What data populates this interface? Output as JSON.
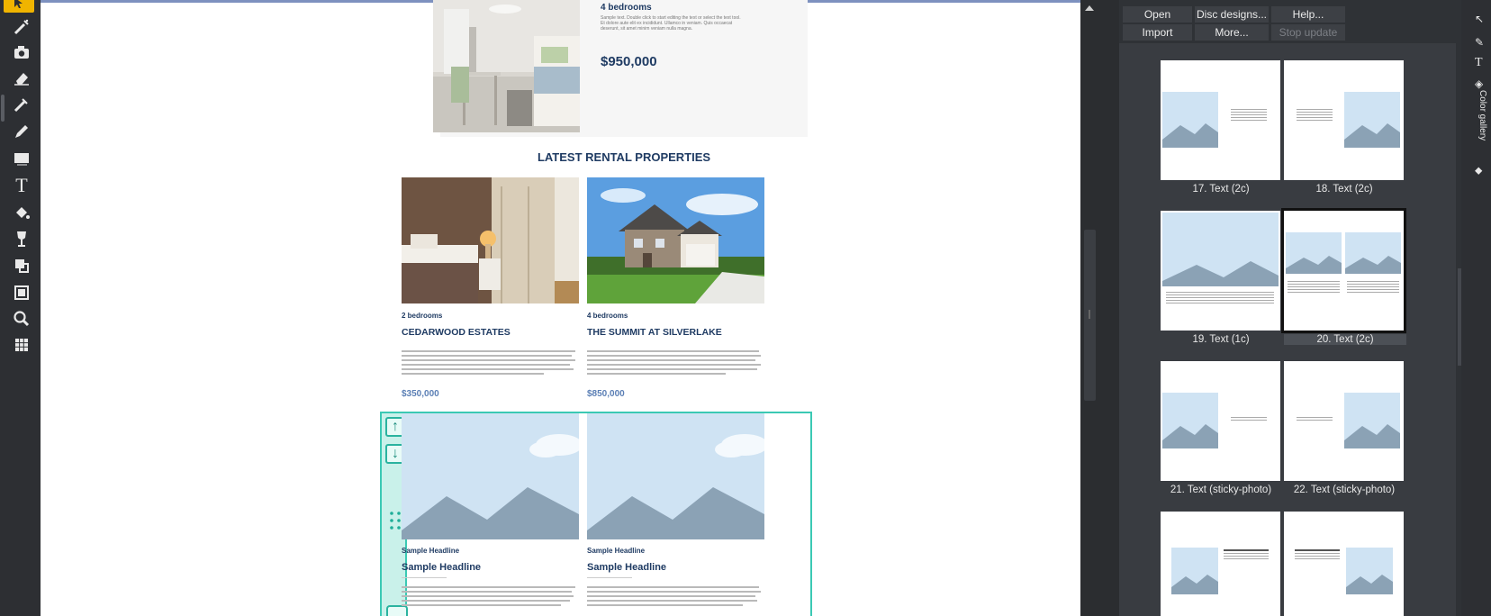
{
  "canvas": {
    "featured": {
      "bedrooms": "4 bedrooms",
      "blurb": "Sample text. Double click to start editing the text or select the text tool. Et dolore aute elit ex incididunt. Ullamco in veniam. Quis occaecat deserunt, sit amet minim veniam nulla magna.",
      "price": "$950,000"
    },
    "section_title": "LATEST RENTAL PROPERTIES",
    "listings": [
      {
        "bedrooms": "2 bedrooms",
        "title": "CEDARWOOD ESTATES",
        "price": "$350,000"
      },
      {
        "bedrooms": "4 bedrooms",
        "title": "THE SUMMIT AT SILVERLAKE",
        "price": "$850,000"
      }
    ],
    "placeholders": [
      {
        "kicker": "Sample Headline",
        "headline": "Sample Headline"
      },
      {
        "kicker": "Sample Headline",
        "headline": "Sample Headline"
      }
    ]
  },
  "panel": {
    "buttons": {
      "open": "Open",
      "disc_designs": "Disc designs...",
      "help": "Help...",
      "import": "Import",
      "more": "More...",
      "stop_update": "Stop update"
    },
    "thumbnails": [
      {
        "label": "17. Text (2c)"
      },
      {
        "label": "18. Text (2c)"
      },
      {
        "label": "19. Text (1c)"
      },
      {
        "label": "20. Text (2c)"
      },
      {
        "label": "21. Text (sticky-photo)"
      },
      {
        "label": "22. Text (sticky-photo)"
      }
    ],
    "side_tab": "Color gallery"
  },
  "colors": {
    "accent_selection": "#3bc9b4",
    "toolbar_active": "#f0b400",
    "heading": "#1f3b63",
    "price_blue": "#5b7fb5"
  }
}
